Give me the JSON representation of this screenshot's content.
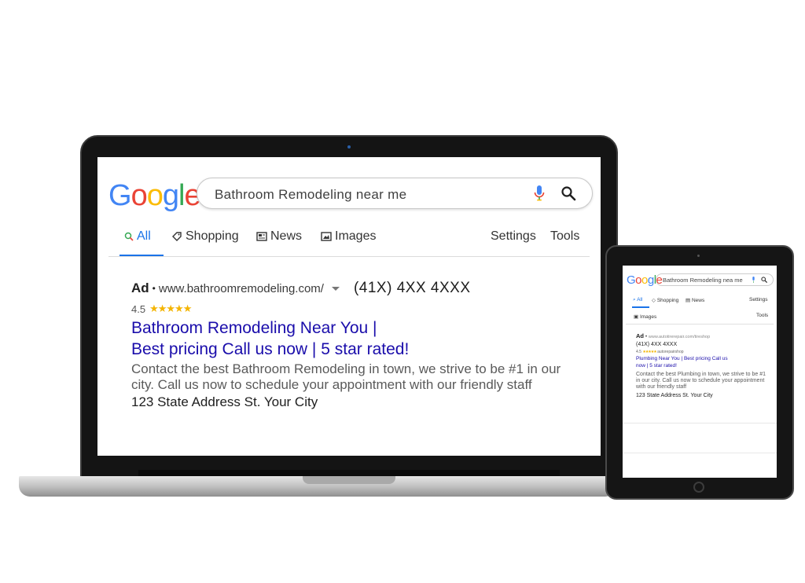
{
  "laptop": {
    "logo": [
      "G",
      "o",
      "o",
      "g",
      "l",
      "e"
    ],
    "search_query": "Bathroom Remodeling near me",
    "tabs": {
      "all": "All",
      "shopping": "Shopping",
      "news": "News",
      "images": "Images",
      "settings": "Settings",
      "tools": "Tools"
    },
    "ad": {
      "badge": "Ad",
      "url": "www.bathroomremodeling.com/",
      "phone": "(41X) 4XX 4XXX",
      "rating": "4.5",
      "stars": "★★★★★",
      "headline_1": "Bathroom Remodeling Near You |",
      "headline_2": "Best pricing Call us now | 5 star rated!",
      "description": "Contact the best Bathroom Remodeling in town, we strive to be #1 in our city. Call us now to schedule your appointment with our friendly staff",
      "address": "123 State Address St. Your City"
    }
  },
  "tablet": {
    "logo": [
      "G",
      "o",
      "o",
      "g",
      "l",
      "e"
    ],
    "search_query": "Bathroom Remodeling nea me",
    "tabs": {
      "all": "All",
      "shopping": "Shopping",
      "news": "News",
      "settings": "Settings",
      "images": "Images",
      "tools": "Tools"
    },
    "ad": {
      "badge": "Ad",
      "url": "www.autotirerepair.com/tireshop",
      "phone": "(41X) 4XX 4XXX",
      "rating": "4.5",
      "stars": "★★★★★",
      "rating_source": "autorepairshop",
      "headline_1": "Plumbing Near You | Best pricing Call us",
      "headline_2": "now | 5 star rated!",
      "description": "Contact the best Plumbing in town, we strive to be #1 in our city. Call us now to schedule your appointment with our friendly staff",
      "address": "123 State Address St. Your City"
    }
  },
  "colors": {
    "google_blue": "#4285f4",
    "google_red": "#ea4335",
    "google_yellow": "#fbbc05",
    "google_green": "#34a853",
    "link": "#1a0dab",
    "active_tab": "#1a73e8",
    "star": "#f4b400"
  }
}
